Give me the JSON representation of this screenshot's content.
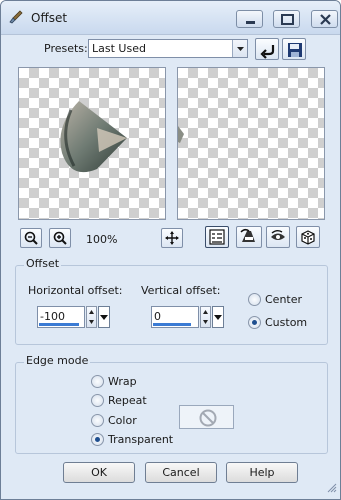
{
  "window": {
    "title": "Offset",
    "icon": "brush-icon",
    "controls": [
      "minimize-icon",
      "maximize-icon",
      "close-icon"
    ]
  },
  "presets": {
    "label": "Presets:",
    "value": "Last Used",
    "reset_icon": "reset-arrow-icon",
    "save_icon": "save-disk-icon"
  },
  "preview": {
    "zoom_out_icon": "zoom-out-icon",
    "zoom_in_icon": "zoom-in-icon",
    "zoom_level": "100%",
    "move_icon": "move-icon",
    "tools": [
      "proof-icon",
      "auto-proof-icon",
      "eye-icon",
      "randomize-icon"
    ]
  },
  "offset": {
    "group_title": "Offset",
    "horizontal_label": "Horizontal offset:",
    "horizontal_value": "-100",
    "vertical_label": "Vertical offset:",
    "vertical_value": "0",
    "options": [
      "Center",
      "Custom"
    ],
    "selected": "Custom"
  },
  "edge_mode": {
    "group_title": "Edge mode",
    "options": [
      "Wrap",
      "Repeat",
      "Color",
      "Transparent"
    ],
    "selected": "Transparent",
    "color_swatch_icon": "no-color-icon"
  },
  "buttons": {
    "ok": "OK",
    "cancel": "Cancel",
    "help": "Help"
  },
  "colors": {
    "dialog_bg": "#dfe9f5",
    "accent": "#3b7bd4"
  }
}
